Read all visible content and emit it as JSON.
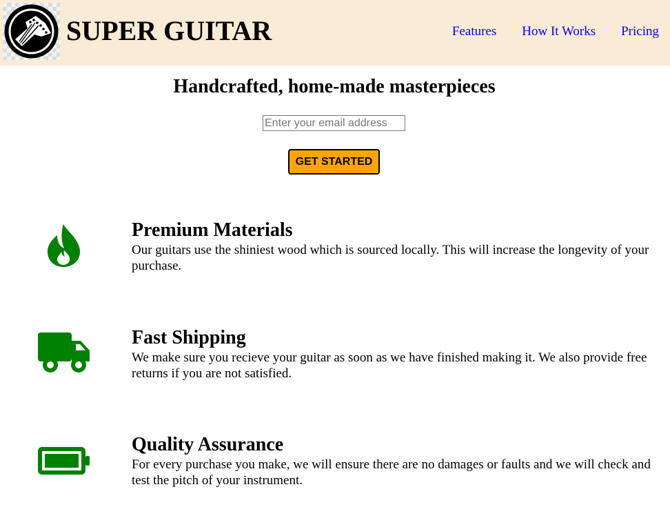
{
  "header": {
    "logo_icon": "guitar-headstock-logo",
    "brand": "SUPER GUITAR",
    "nav": [
      {
        "label": "Features"
      },
      {
        "label": "How It Works"
      },
      {
        "label": "Pricing"
      }
    ]
  },
  "hero": {
    "title": "Handcrafted, home-made masterpieces",
    "email_placeholder": "Enter your email address",
    "email_value": "",
    "cta_label": "GET STARTED"
  },
  "features": [
    {
      "icon": "fire-icon",
      "title": "Premium Materials",
      "text": "Our guitars use the shiniest wood which is sourced locally. This will increase the longevity of your purchase."
    },
    {
      "icon": "truck-icon",
      "title": "Fast Shipping",
      "text": "We make sure you recieve your guitar as soon as we have finished making it. We also provide free returns if you are not satisfied."
    },
    {
      "icon": "battery-full-icon",
      "title": "Quality Assurance",
      "text": "For every purchase you make, we will ensure there are no damages or faults and we will check and test the pitch of your instrument."
    }
  ],
  "colors": {
    "header_bg": "#faebd7",
    "link": "#0000ee",
    "cta_bg": "#ffa500",
    "icon": "#008000"
  }
}
